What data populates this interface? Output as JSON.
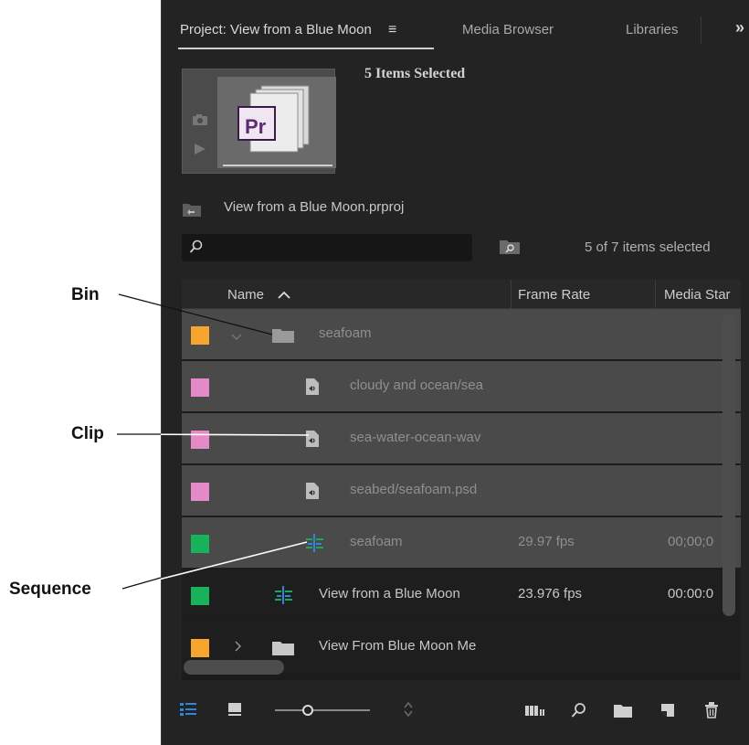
{
  "tabs": {
    "project": "Project: View from a Blue Moon",
    "media_browser": "Media Browser",
    "libraries": "Libraries",
    "overflow": "»"
  },
  "preview": {
    "title": "5 Items Selected",
    "badge": "Pr"
  },
  "project_file": "View from a Blue Moon.prproj",
  "search": {
    "placeholder": ""
  },
  "selection_count": "5 of 7 items selected",
  "table": {
    "columns": [
      "Name",
      "Frame Rate",
      "Media Star"
    ],
    "rows": [
      {
        "name": "seafoam",
        "type": "bin",
        "color": "#f6a52e",
        "frame_rate": "",
        "media_start": "",
        "selected": true,
        "expanded": true
      },
      {
        "name": "cloudy and ocean/sea",
        "type": "clip",
        "color": "#e58ac8",
        "frame_rate": "",
        "media_start": "",
        "selected": true
      },
      {
        "name": "sea-water-ocean-wav",
        "type": "clip",
        "color": "#e58ac8",
        "frame_rate": "",
        "media_start": "",
        "selected": true
      },
      {
        "name": "seabed/seafoam.psd",
        "type": "clip",
        "color": "#e58ac8",
        "frame_rate": "",
        "media_start": "",
        "selected": true
      },
      {
        "name": "seafoam",
        "type": "sequence",
        "color": "#17b25a",
        "frame_rate": "29.97 fps",
        "media_start": "00;00;0",
        "selected": true
      },
      {
        "name": "View from a Blue Moon",
        "type": "sequence",
        "color": "#17b25a",
        "frame_rate": "23.976 fps",
        "media_start": "00:00:0",
        "selected": false
      },
      {
        "name": "View From Blue Moon Me",
        "type": "bin",
        "color": "#f6a52e",
        "frame_rate": "",
        "media_start": "",
        "selected": false,
        "expanded": false
      }
    ]
  },
  "callouts": {
    "bin": "Bin",
    "clip": "Clip",
    "sequence": "Sequence"
  },
  "colors": {
    "panel_bg": "#232323",
    "selected_row": "#4a4a4a",
    "accent_blue": "#2f86d6"
  }
}
